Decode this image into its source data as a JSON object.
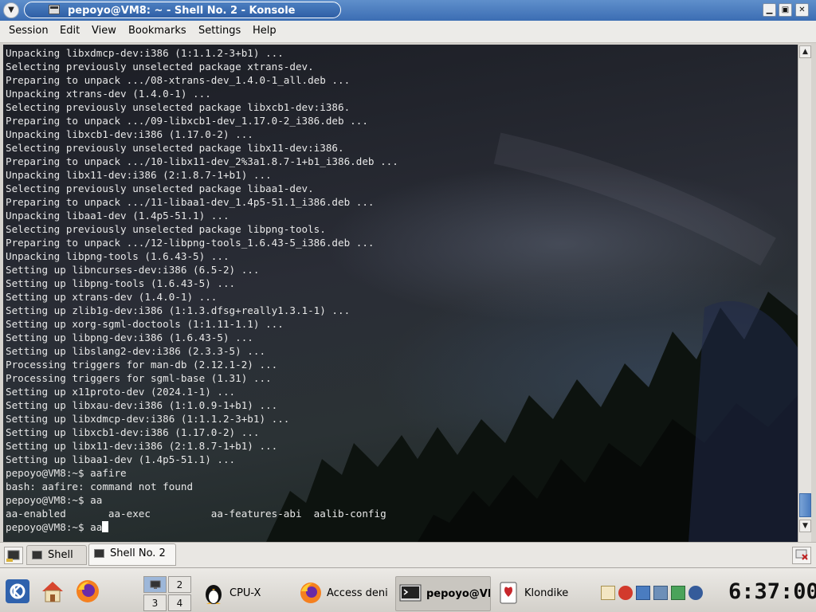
{
  "window": {
    "title": "pepoyo@VM8: ~ - Shell No. 2 - Konsole"
  },
  "menubar": {
    "items": [
      "Session",
      "Edit",
      "View",
      "Bookmarks",
      "Settings",
      "Help"
    ]
  },
  "terminal": {
    "lines": [
      "Unpacking libxdmcp-dev:i386 (1:1.1.2-3+b1) ...",
      "Selecting previously unselected package xtrans-dev.",
      "Preparing to unpack .../08-xtrans-dev_1.4.0-1_all.deb ...",
      "Unpacking xtrans-dev (1.4.0-1) ...",
      "Selecting previously unselected package libxcb1-dev:i386.",
      "Preparing to unpack .../09-libxcb1-dev_1.17.0-2_i386.deb ...",
      "Unpacking libxcb1-dev:i386 (1.17.0-2) ...",
      "Selecting previously unselected package libx11-dev:i386.",
      "Preparing to unpack .../10-libx11-dev_2%3a1.8.7-1+b1_i386.deb ...",
      "Unpacking libx11-dev:i386 (2:1.8.7-1+b1) ...",
      "Selecting previously unselected package libaa1-dev.",
      "Preparing to unpack .../11-libaa1-dev_1.4p5-51.1_i386.deb ...",
      "Unpacking libaa1-dev (1.4p5-51.1) ...",
      "Selecting previously unselected package libpng-tools.",
      "Preparing to unpack .../12-libpng-tools_1.6.43-5_i386.deb ...",
      "Unpacking libpng-tools (1.6.43-5) ...",
      "Setting up libncurses-dev:i386 (6.5-2) ...",
      "Setting up libpng-tools (1.6.43-5) ...",
      "Setting up xtrans-dev (1.4.0-1) ...",
      "Setting up zlib1g-dev:i386 (1:1.3.dfsg+really1.3.1-1) ...",
      "Setting up xorg-sgml-doctools (1:1.11-1.1) ...",
      "Setting up libpng-dev:i386 (1.6.43-5) ...",
      "Setting up libslang2-dev:i386 (2.3.3-5) ...",
      "Processing triggers for man-db (2.12.1-2) ...",
      "Processing triggers for sgml-base (1.31) ...",
      "Setting up x11proto-dev (2024.1-1) ...",
      "Setting up libxau-dev:i386 (1:1.0.9-1+b1) ...",
      "Setting up libxdmcp-dev:i386 (1:1.1.2-3+b1) ...",
      "Setting up libxcb1-dev:i386 (1.17.0-2) ...",
      "Setting up libx11-dev:i386 (2:1.8.7-1+b1) ...",
      "Setting up libaa1-dev (1.4p5-51.1) ...",
      "pepoyo@VM8:~$ aafire",
      "bash: aafire: command not found",
      "pepoyo@VM8:~$ aa",
      "aa-enabled       aa-exec          aa-features-abi  aalib-config"
    ],
    "prompt": "pepoyo@VM8:~$ ",
    "current_input": "aa"
  },
  "tabs": [
    {
      "label": "Shell",
      "active": false
    },
    {
      "label": "Shell No. 2",
      "active": true
    }
  ],
  "panel": {
    "pager": [
      "1",
      "2",
      "3",
      "4"
    ],
    "active_desktop": "1",
    "tasks": [
      {
        "label": "CPU-X",
        "icon": "tux-icon"
      },
      {
        "label": "Access deni",
        "icon": "firefox-icon"
      },
      {
        "label": "pepoyo@VM",
        "icon": "terminal-icon",
        "active": true
      },
      {
        "label": "Klondike",
        "icon": "cards-icon"
      }
    ],
    "clock": "6:37:00"
  },
  "colors": {
    "titlebar": "#4a7cc0",
    "terminal_text": "#e8e8e8",
    "panel": "#e0ded9"
  }
}
